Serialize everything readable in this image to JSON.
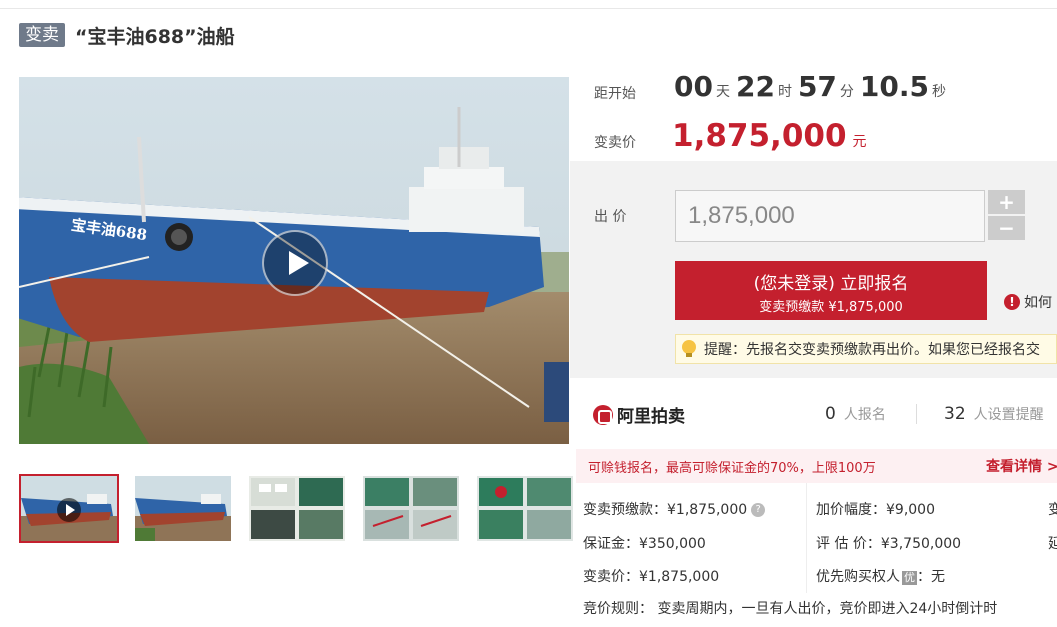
{
  "header": {
    "tag": "变卖",
    "title": "“宝丰油688”油船"
  },
  "media": {
    "main_image_alt": "宝丰油688",
    "hull_label": "宝丰油688",
    "thumbnails": [
      {
        "kind": "video",
        "active": true
      },
      {
        "kind": "photo",
        "active": false
      },
      {
        "kind": "photo",
        "active": false
      },
      {
        "kind": "photo",
        "active": false
      },
      {
        "kind": "photo",
        "active": false
      }
    ]
  },
  "countdown": {
    "label": "距开始",
    "days": "00",
    "days_unit": "天",
    "hours": "22",
    "hours_unit": "时",
    "minutes": "57",
    "minutes_unit": "分",
    "seconds": "10.5",
    "seconds_unit": "秒"
  },
  "price": {
    "label": "变卖价",
    "value": "1,875,000",
    "unit": "元"
  },
  "bid": {
    "label": "出 价",
    "input_value": "1,875,000",
    "plus": "+",
    "minus": "−",
    "signup_line1": "(您未登录) 立即报名",
    "signup_line2": "变卖预缴款 ¥1,875,000",
    "howto": "如何",
    "reminder": "提醒：先报名交变卖预缴款再出价。如果您已经报名交"
  },
  "stats": {
    "brand": "阿里拍卖",
    "registered_count": "0",
    "registered_label": "人报名",
    "reminder_count": "32",
    "reminder_label": "人设置提醒"
  },
  "promo": {
    "text": "可赊钱报名，最高可赊保证金的70%，上限100万",
    "more": "查看详情 >"
  },
  "details": {
    "deposit": "变卖预缴款：¥1,875,000",
    "increment": "加价幅度：¥9,000",
    "guarantee": "保证金：¥350,000",
    "appraisal": "评 估 价：¥3,750,000",
    "sale_price": "变卖价：¥1,875,000",
    "priority": "优先购买权人",
    "priority_badge": "优",
    "priority_value": "：无",
    "rules": "竞价规则：  变卖周期内，一旦有人出价，竞价即进入24小时倒计时",
    "cut_col3_1": "变",
    "cut_col3_2": "延"
  },
  "colors": {
    "accent_red": "#c4202e",
    "tag_gray": "#6f7a8a",
    "panel_gray": "#f2f2f2"
  }
}
